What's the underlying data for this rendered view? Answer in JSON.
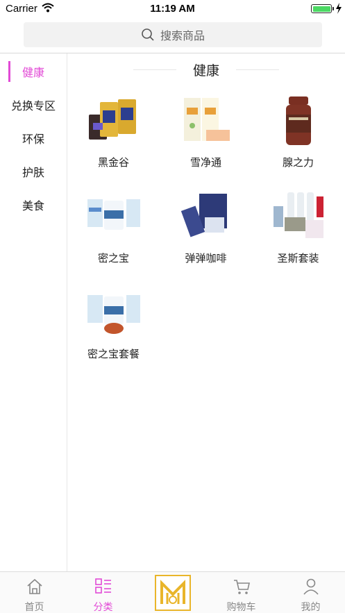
{
  "status": {
    "carrier": "Carrier",
    "time": "11:19 AM",
    "battery_level": 1.0
  },
  "search": {
    "placeholder": "搜索商品",
    "icon": "search-icon"
  },
  "sidebar": {
    "items": [
      {
        "label": "健康",
        "active": true
      },
      {
        "label": "兑换专区",
        "active": false
      },
      {
        "label": "环保",
        "active": false
      },
      {
        "label": "护肤",
        "active": false
      },
      {
        "label": "美食",
        "active": false
      }
    ]
  },
  "main": {
    "section_title": "健康",
    "products": [
      {
        "name": "黑金谷",
        "icon": "grain-bag-product-image"
      },
      {
        "name": "雪净通",
        "icon": "box-product-image"
      },
      {
        "name": "腺之力",
        "icon": "bottle-product-image"
      },
      {
        "name": "密之宝",
        "icon": "sachet-product-image"
      },
      {
        "name": "弹弹咖啡",
        "icon": "coffee-box-product-image"
      },
      {
        "name": "圣斯套装",
        "icon": "cleaner-set-product-image"
      },
      {
        "name": "密之宝套餐",
        "icon": "sachet-set-product-image"
      }
    ]
  },
  "tabbar": {
    "items": [
      {
        "label": "首页",
        "icon": "home-icon",
        "active": false
      },
      {
        "label": "分类",
        "icon": "category-icon",
        "active": true
      },
      {
        "label": "",
        "icon": "brand-logo-icon",
        "active": false
      },
      {
        "label": "购物车",
        "icon": "cart-icon",
        "active": false
      },
      {
        "label": "我的",
        "icon": "user-icon",
        "active": false
      }
    ]
  },
  "colors": {
    "accent": "#e24ad6",
    "logo_gold": "#e9b52a",
    "battery": "#4cd964"
  }
}
